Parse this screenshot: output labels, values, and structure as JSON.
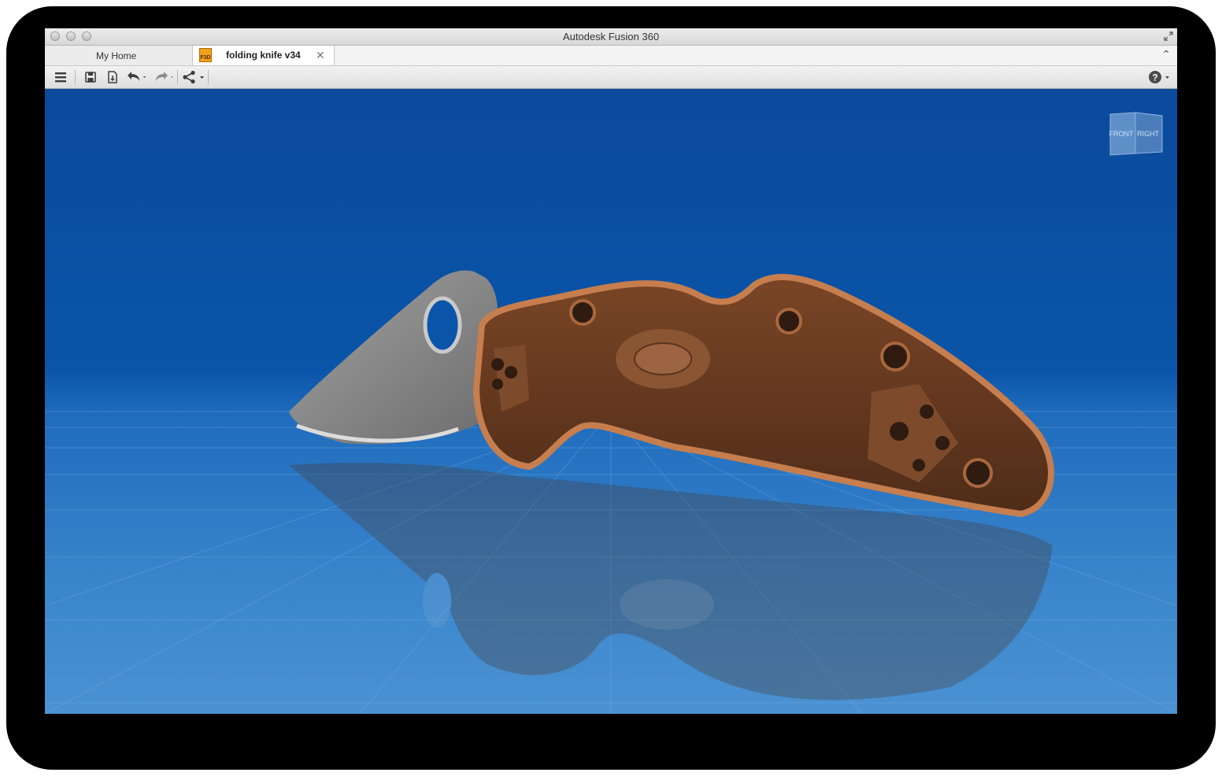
{
  "window": {
    "title": "Autodesk Fusion 360"
  },
  "tabs": {
    "home_label": "My Home",
    "document_label": "folding knife v34",
    "document_icon_text": "F3D",
    "close_glyph": "✕",
    "collapse_glyph": "⌃"
  },
  "toolbar": {
    "icons": [
      "menu-icon",
      "save-icon",
      "export-icon",
      "undo-icon",
      "redo-icon",
      "share-icon",
      "help-icon"
    ],
    "help_glyph": "?"
  },
  "viewcube": {
    "front_label": "FRONT",
    "right_label": "RIGHT"
  },
  "colors": {
    "viewport_top": "#0b4a9c",
    "viewport_floor": "#3b86cc",
    "handle": "#6a3d20",
    "handle_rim": "#c67e4e",
    "blade": "#8c8c8c"
  }
}
